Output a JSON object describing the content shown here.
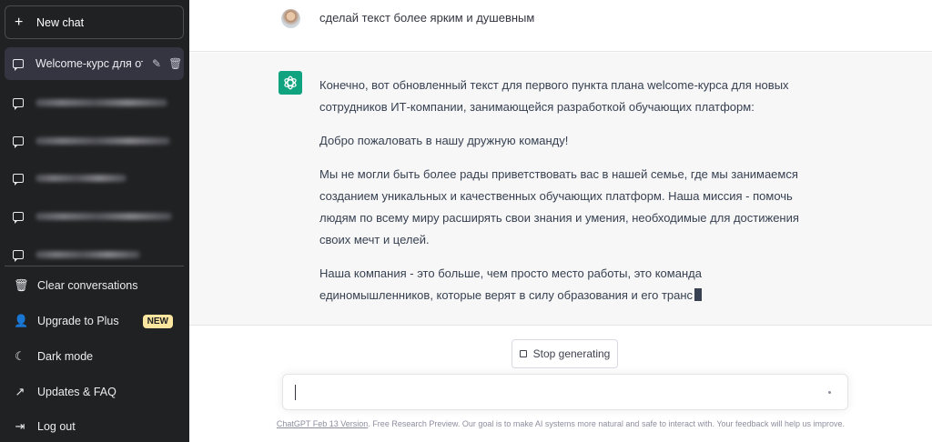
{
  "sidebar": {
    "new_chat_label": "New chat",
    "conversations": [
      {
        "label": "Welcome-курс для отд",
        "active": true
      },
      {
        "label": "",
        "blurred": true
      },
      {
        "label": "",
        "blurred": true
      },
      {
        "label": "",
        "blurred": true
      },
      {
        "label": "",
        "blurred": true
      },
      {
        "label": "",
        "blurred": true
      }
    ],
    "menu": {
      "clear": "Clear conversations",
      "upgrade": "Upgrade to Plus",
      "upgrade_badge": "NEW",
      "dark_mode": "Dark mode",
      "updates": "Updates & FAQ",
      "logout": "Log out"
    }
  },
  "messages": {
    "user": "сделай текст более ярким и душевным",
    "assistant": [
      "Конечно, вот обновленный текст для первого пункта плана welcome-курса для новых сотрудников ИТ-компании, занимающейся разработкой обучающих платформ:",
      "Добро пожаловать в нашу дружную команду!",
      "Мы не могли быть более рады приветствовать вас в нашей семье, где мы занимаемся созданием уникальных и качественных обучающих платформ. Наша миссия - помочь людям по всему миру расширять свои знания и умения, необходимые для достижения своих мечт и целей.",
      "Наша компания - это больше, чем просто место работы, это команда единомышленников, которые верят в силу образования и его транс"
    ]
  },
  "controls": {
    "stop_label": "Stop generating",
    "input_value": ""
  },
  "footer": {
    "link": "ChatGPT Feb 13 Version",
    "text": ". Free Research Preview. Our goal is to make AI systems more natural and safe to interact with. Your feedback will help us improve."
  },
  "colors": {
    "sidebar_bg": "#202123",
    "accent_green": "#10a37f",
    "badge_bg": "#fae69e"
  }
}
